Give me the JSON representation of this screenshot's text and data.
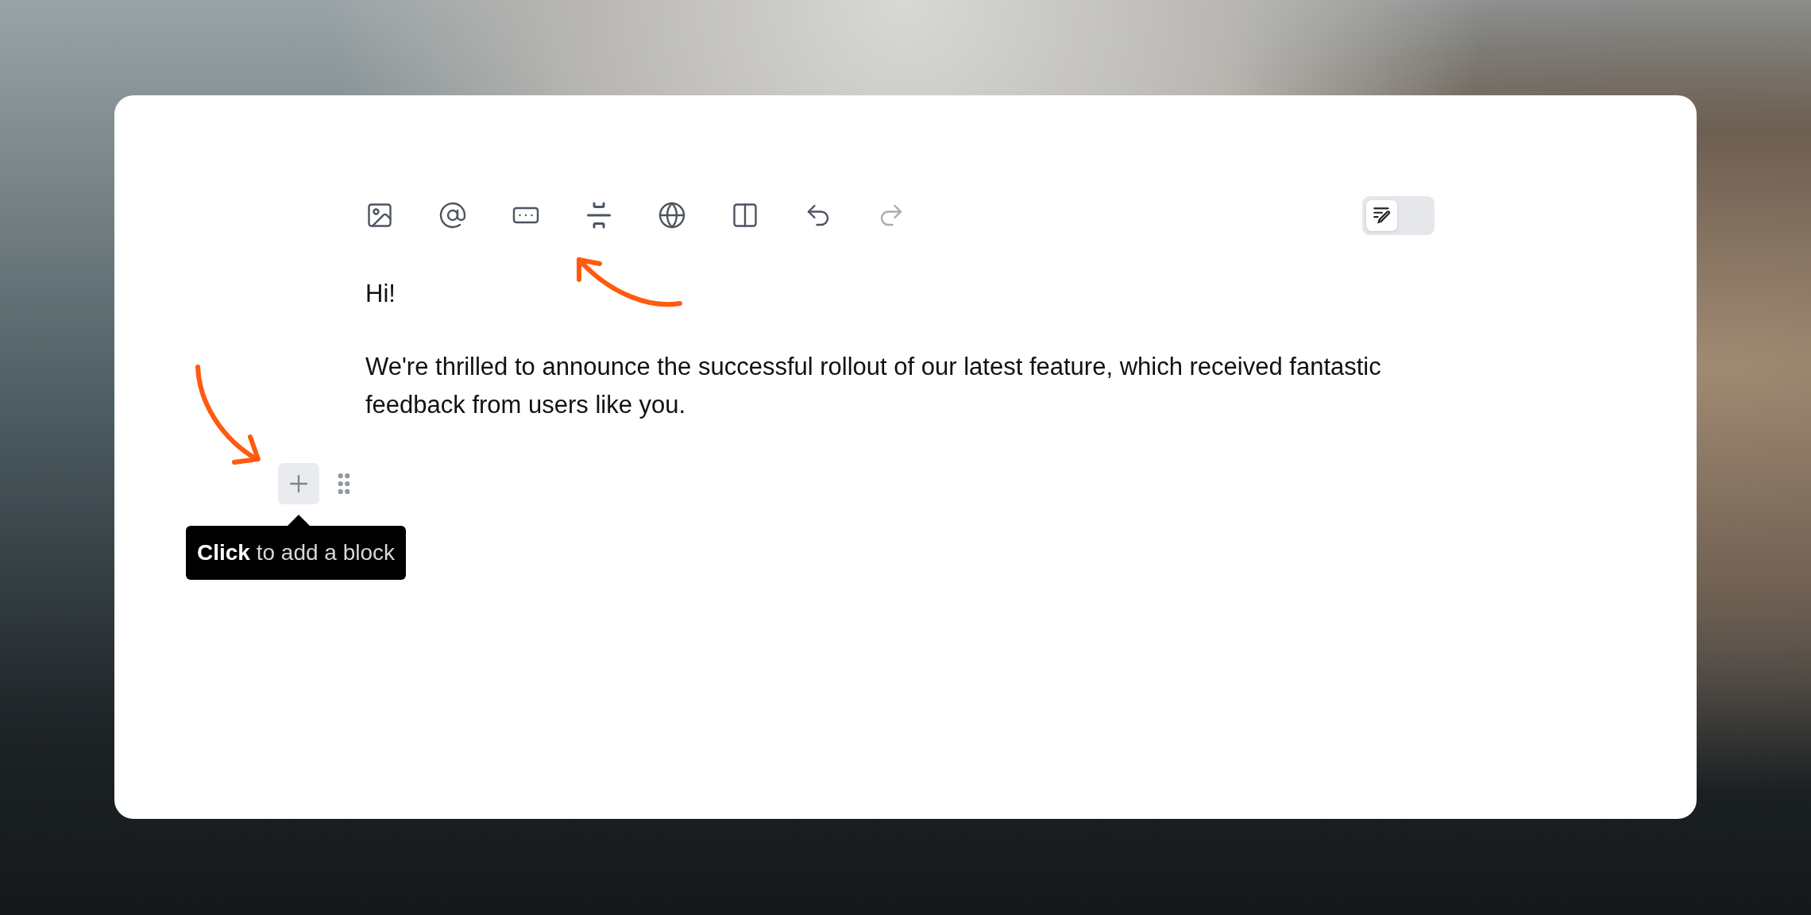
{
  "toolbar": [
    {
      "kind": "image",
      "disabled": false
    },
    {
      "kind": "mention",
      "disabled": false
    },
    {
      "kind": "button",
      "disabled": false
    },
    {
      "kind": "divider",
      "disabled": false
    },
    {
      "kind": "embed",
      "disabled": false
    },
    {
      "kind": "columns",
      "disabled": false
    },
    {
      "kind": "undo",
      "disabled": false
    },
    {
      "kind": "redo",
      "disabled": true
    }
  ],
  "mode_toggle": {
    "on": false
  },
  "content": [
    "Hi!",
    "We're thrilled to announce the successful rollout of our latest feature, which received fantastic feedback from users like you."
  ],
  "block_handle": {
    "tooltip": "**Click** to add a block"
  }
}
